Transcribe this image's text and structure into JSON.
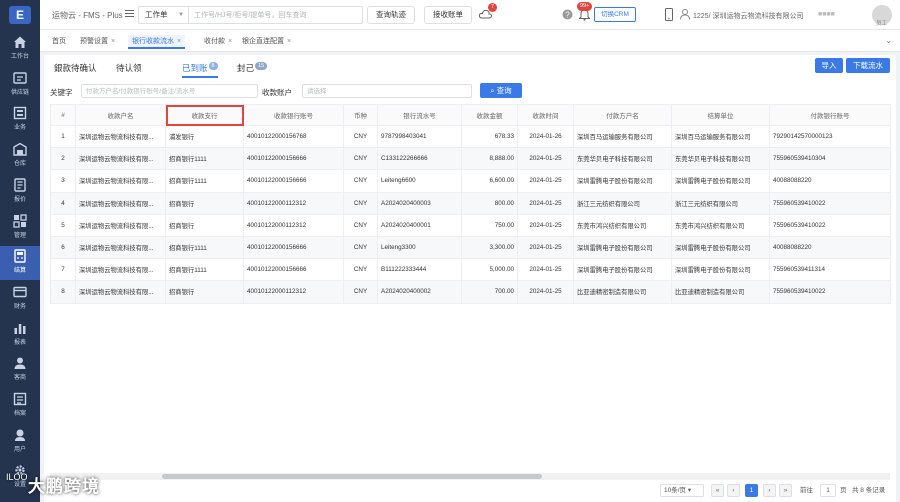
{
  "app": {
    "title": "运物云 - FMS - Plus",
    "logo": "E"
  },
  "sidebar": {
    "items": [
      {
        "label": "工作台",
        "icon": "home-icon"
      },
      {
        "label": "供应链",
        "icon": "supply-icon"
      },
      {
        "label": "业务",
        "icon": "business-icon"
      },
      {
        "label": "仓库",
        "icon": "warehouse-icon"
      },
      {
        "label": "报价",
        "icon": "quote-icon"
      },
      {
        "label": "管理",
        "icon": "manage-icon"
      },
      {
        "label": "结算",
        "icon": "settle-icon"
      },
      {
        "label": "财务",
        "icon": "finance-icon"
      },
      {
        "label": "报表",
        "icon": "report-icon"
      },
      {
        "label": "客商",
        "icon": "customer-icon"
      },
      {
        "label": "档案",
        "icon": "archive-icon"
      },
      {
        "label": "用户",
        "icon": "user-icon"
      },
      {
        "label": "设置",
        "icon": "gear-icon"
      }
    ]
  },
  "topbar": {
    "search_type": "工作单",
    "search_placeholder": "工作号/HJ号/柜号/提单号，回车查询",
    "query_track_label": "查询轨迹",
    "receive_bill_label": "接收账单",
    "cloud_badge": "7",
    "bell_badge": "99+",
    "switch_label": "切换CRM",
    "company": "1225/ 深圳运物云物流科技有限公司",
    "username": "■■■■",
    "user_sub": "员工"
  },
  "page_tabs": [
    {
      "label": "首页",
      "closable": false
    },
    {
      "label": "预警设置",
      "closable": true
    },
    {
      "label": "银行收款流水",
      "closable": true,
      "active": true
    },
    {
      "label": "收付款",
      "closable": true
    },
    {
      "label": "银企直连配置",
      "closable": true
    }
  ],
  "sub_tabs": [
    {
      "label": "銀款待确认",
      "count": ""
    },
    {
      "label": "待认领",
      "count": ""
    },
    {
      "label": "已到账",
      "count": "8",
      "active": true
    },
    {
      "label": "封己",
      "count": "15"
    }
  ],
  "actions": {
    "import_label": "导入",
    "download_label": "下载流水"
  },
  "filters": {
    "keyword_label": "关键字",
    "keyword_placeholder": "付款方户名/付款银行账号/备注/流水号",
    "account_label": "收款账户",
    "account_placeholder": "请选择",
    "query_label": "查询"
  },
  "table": {
    "columns": [
      "#",
      "收款户名",
      "收款支行",
      "收款银行账号",
      "币种",
      "银行流水号",
      "收款金额",
      "收款时间",
      "付款方户名",
      "结算单位",
      "付款银行账号"
    ],
    "rows": [
      [
        "1",
        "深圳运物云物流科技有限...",
        "浦发银行",
        "40010122000156768",
        "CNY",
        "9787998403041",
        "678.33",
        "2024-01-26",
        "深圳百马运输服务有限公司",
        "深圳百马运输服务有限公司",
        "79290142570000123"
      ],
      [
        "2",
        "深圳运物云物流科技有限...",
        "招商银行1111",
        "40010122000156666",
        "CNY",
        "C133122266666",
        "8,888.00",
        "2024-01-25",
        "东莞华贝电子科技有限公司",
        "东莞华贝电子科技有限公司",
        "755960539410304"
      ],
      [
        "3",
        "深圳运物云物流科技有限...",
        "招商银行1111",
        "40010122000156666",
        "CNY",
        "Leiteng6600",
        "6,600.00",
        "2024-01-25",
        "深圳雷腾电子股份有限公司",
        "深圳雷腾电子股份有限公司",
        "40088088220"
      ],
      [
        "4",
        "深圳运物云物流科技有限...",
        "招商银行",
        "40010122000112312",
        "CNY",
        "A2024020400003",
        "800.00",
        "2024-01-25",
        "浙江三元纺织有限公司",
        "浙江三元纺织有限公司",
        "755960539410022"
      ],
      [
        "5",
        "深圳运物云物流科技有限...",
        "招商银行",
        "40010122000112312",
        "CNY",
        "A2024020400001",
        "750.00",
        "2024-01-25",
        "东莞市鸿兴纺织有限公司",
        "东莞市鸿兴纺织有限公司",
        "755960539410022"
      ],
      [
        "6",
        "深圳运物云物流科技有限...",
        "招商银行1111",
        "40010122000156666",
        "CNY",
        "Leiteng3300",
        "3,300.00",
        "2024-01-25",
        "深圳雷腾电子股份有限公司",
        "深圳雷腾电子股份有限公司",
        "40088088220"
      ],
      [
        "7",
        "深圳运物云物流科技有限...",
        "招商银行1111",
        "40010122000156666",
        "CNY",
        "B111222333444",
        "5,000.00",
        "2024-01-25",
        "深圳雷腾电子股份有限公司",
        "深圳雷腾电子股份有限公司",
        "755960539411314"
      ],
      [
        "8",
        "深圳运物云物流科技有限...",
        "招商银行",
        "40010122000112312",
        "CNY",
        "A2024020400002",
        "700.00",
        "2024-01-25",
        "比亚迪精密制造有限公司",
        "比亚迪精密制造有限公司",
        "755960539410022"
      ]
    ]
  },
  "pagination": {
    "page_size": "10条/页",
    "current_page": "1",
    "goto_label": "前往",
    "goto_value": "1",
    "unit": "页",
    "total": "共 8 条记录"
  },
  "watermark": {
    "text": "大鹏跨境",
    "mark": "ILOO"
  },
  "colors": {
    "primary": "#3a7ae8",
    "sidebar": "#24344f",
    "highlight": "#e2453c"
  }
}
